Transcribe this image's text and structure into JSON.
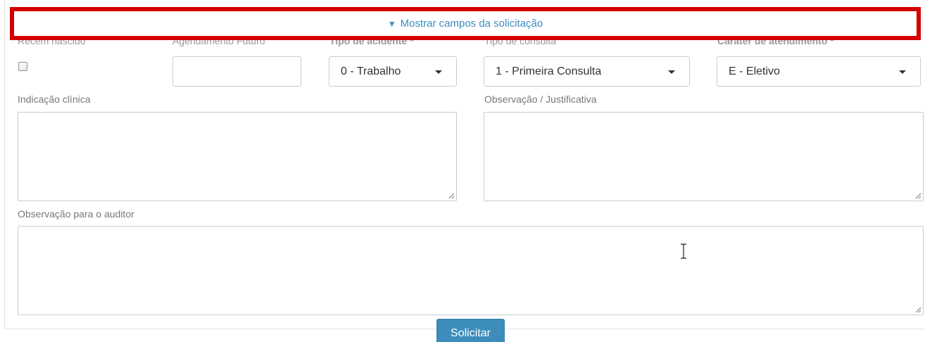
{
  "toggle": {
    "arrow": "▼",
    "label": "Mostrar campos da solicitação"
  },
  "fields": {
    "recem_nascido": {
      "label": "Recém nascido"
    },
    "agendamento_futuro": {
      "label": "Agendamento Futuro",
      "value": "",
      "icon": "calendar-icon"
    },
    "tipo_acidente": {
      "label": "Tipo de acidente *",
      "value": "0 - Trabalho"
    },
    "tipo_consulta": {
      "label": "Tipo de consulta",
      "value": "1 - Primeira Consulta"
    },
    "carater_atendimento": {
      "label": "Caráter de atendimento *",
      "value": "E - Eletivo"
    },
    "indicacao_clinica": {
      "label": "Indicação clínica",
      "value": ""
    },
    "observacao_justificativa": {
      "label": "Observação / Justificativa",
      "value": ""
    },
    "observacao_auditor": {
      "label": "Observação para o auditor",
      "value": ""
    }
  },
  "actions": {
    "submit_label": "Solicitar"
  },
  "colors": {
    "accent": "#3c8dbc",
    "highlight": "#d40000"
  }
}
